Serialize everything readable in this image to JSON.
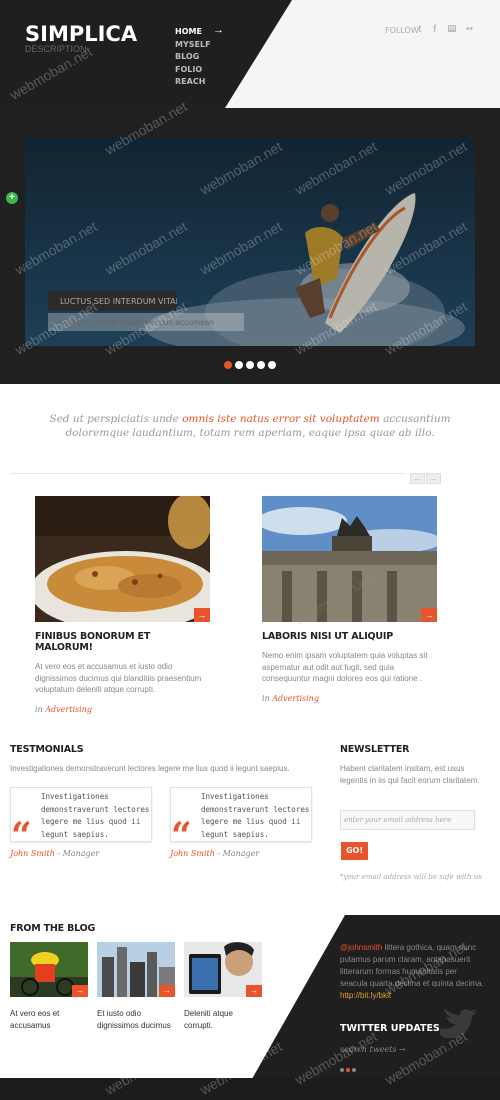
{
  "header": {
    "logo": "SIMPLICA",
    "description": "DESCRIPTION",
    "nav": [
      "HOME",
      "MYSELF",
      "BLOG",
      "FOLIO",
      "REACH"
    ],
    "nav_arrow": "→",
    "follow": "FOLLOW",
    "social": {
      "twitter": "t",
      "facebook": "f",
      "linkedin": "in",
      "flickr": "••"
    }
  },
  "slider": {
    "caption_title": "LUCTUS SED INTERDUM VITAE",
    "caption_text": "Fusce eu nisl at ipsum tempus accumsan",
    "dots": 5,
    "active_dot": 0,
    "plus": "+"
  },
  "quote": {
    "before": "Sed ut perspiciatis unde ",
    "highlight": "omnis iste natus error sit voluptatem",
    "after": " accusantium doloremque laudantium, totam rem aperiam, eaque ipsa quae ab illo."
  },
  "carousel_nav": {
    "prev": "←",
    "next": "→"
  },
  "posts": [
    {
      "title": "FINIBUS BONORUM ET MALORUM!",
      "excerpt": "At vero eos et accusamus et iusto odio dignissimos ducimus qui blanditiis praesentium voluptatum deleniti atque corrupti.",
      "category_prefix": "in ",
      "category": "Advertising",
      "arrow": "→"
    },
    {
      "title": "LABORIS NISI UT ALIQUIP",
      "excerpt": "Nemo enim ipsam voluptatem quia voluptas sit aspernatur aut odit aut fugit, sed quia consequuntur magni dolores eos qui ratione .",
      "category_prefix": "in ",
      "category": "Advertising",
      "arrow": "→"
    }
  ],
  "testimonials": {
    "title": "TESTMONIALS",
    "intro": "Investigationes demonstraverunt lectores legere me lius quod ii legunt saepius.",
    "items": [
      {
        "text": "Investigationes demonstraverunt lectores legere me lius quod ii legunt saepius.",
        "name": "John Smith",
        "role": " - Manager"
      },
      {
        "text": "Investigationes demonstraverunt lectores legere me lius quod ii legunt saepius.",
        "name": "John Smith",
        "role": " - Manager"
      }
    ],
    "quote_mark": "“"
  },
  "newsletter": {
    "title": "NEWSLETTER",
    "text": "Habent claritatem insitam, est usus legentis in iis qui facit eorum claritatem.",
    "placeholder": "enter your email address here",
    "button": "GO!",
    "note": "*your email address will be safe with us"
  },
  "blog": {
    "title": "FROM THE BLOG",
    "items": [
      {
        "caption": "At vero eos et accusamus",
        "arrow": "→"
      },
      {
        "caption": "Et iusto odio dignissimos ducimus",
        "arrow": "→"
      },
      {
        "caption": "Deleniti atque corrupti.",
        "arrow": "→"
      }
    ]
  },
  "twitter": {
    "user": "@johnsmith",
    "text": " littera gothica, quam nunc putamus parum claram, anteposuerit litterarum formas humanitatis per seacula quarta decima et quinta decima. ",
    "link": "http://bit.ly/bklt",
    "title": "TWITTER UPDATES",
    "search": "search tweets →"
  },
  "watermark": "webmoban.net",
  "colors": {
    "accent": "#e8542c",
    "dark": "#202020"
  }
}
